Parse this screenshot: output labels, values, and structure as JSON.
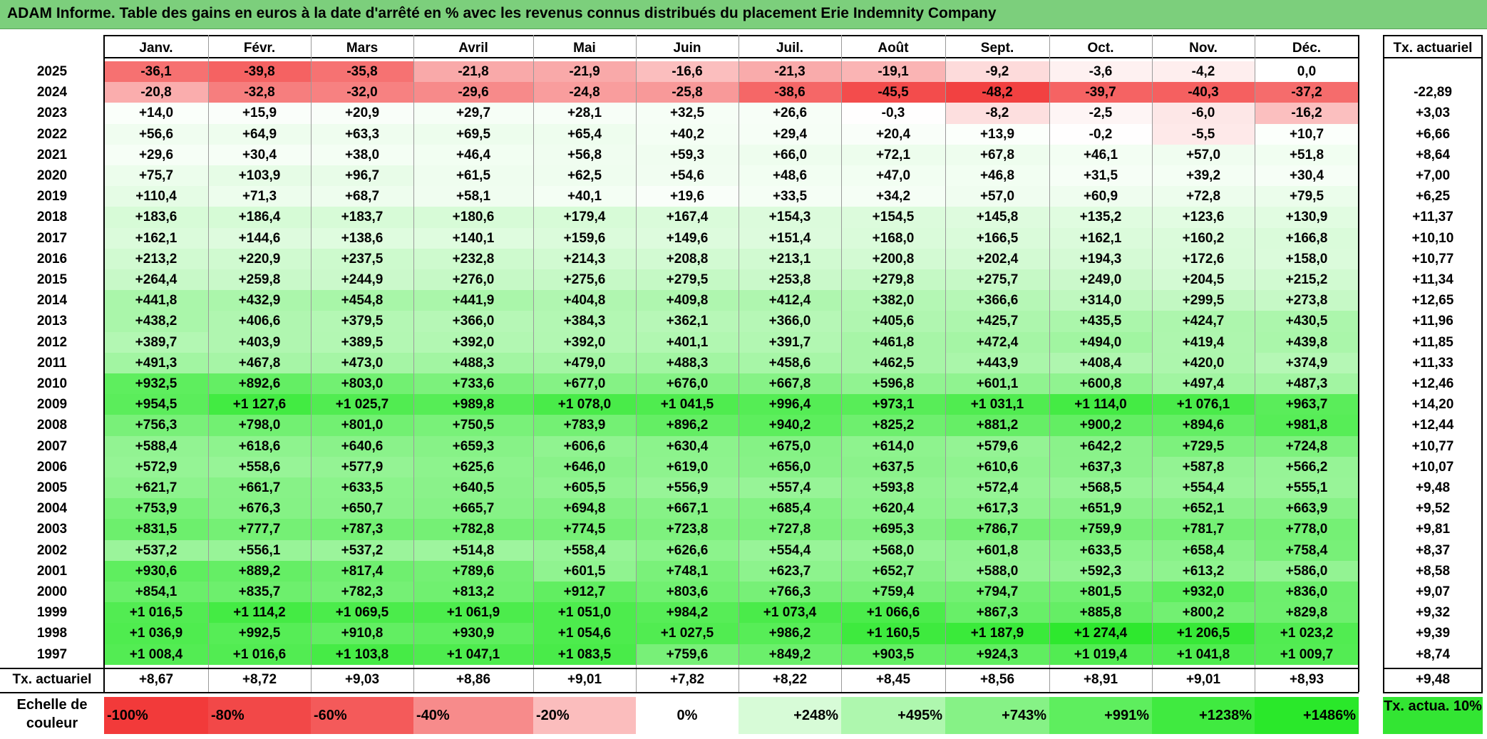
{
  "title": "ADAM Informe. Table des gains en euros à la date d'arrêté en % avec les revenus connus distribués du placement Erie Indemnity Company",
  "months": [
    "Janv.",
    "Févr.",
    "Mars",
    "Avril",
    "Mai",
    "Juin",
    "Juil.",
    "Août",
    "Sept.",
    "Oct.",
    "Nov.",
    "Déc."
  ],
  "rate_header": "Tx. actuariel",
  "rows": [
    {
      "year": "2025",
      "values": [
        "-36,1",
        "-39,8",
        "-35,8",
        "-21,8",
        "-21,9",
        "-16,6",
        "-21,3",
        "-19,1",
        "-9,2",
        "-3,6",
        "-4,2",
        "0,0"
      ],
      "rate": ""
    },
    {
      "year": "2024",
      "values": [
        "-20,8",
        "-32,8",
        "-32,0",
        "-29,6",
        "-24,8",
        "-25,8",
        "-38,6",
        "-45,5",
        "-48,2",
        "-39,7",
        "-40,3",
        "-37,2"
      ],
      "rate": "-22,89"
    },
    {
      "year": "2023",
      "values": [
        "+14,0",
        "+15,9",
        "+20,9",
        "+29,7",
        "+28,1",
        "+32,5",
        "+26,6",
        "-0,3",
        "-8,2",
        "-2,5",
        "-6,0",
        "-16,2"
      ],
      "rate": "+3,03"
    },
    {
      "year": "2022",
      "values": [
        "+56,6",
        "+64,9",
        "+63,3",
        "+69,5",
        "+65,4",
        "+40,2",
        "+29,4",
        "+20,4",
        "+13,9",
        "-0,2",
        "-5,5",
        "+10,7"
      ],
      "rate": "+6,66"
    },
    {
      "year": "2021",
      "values": [
        "+29,6",
        "+30,4",
        "+38,0",
        "+46,4",
        "+56,8",
        "+59,3",
        "+66,0",
        "+72,1",
        "+67,8",
        "+46,1",
        "+57,0",
        "+51,8"
      ],
      "rate": "+8,64"
    },
    {
      "year": "2020",
      "values": [
        "+75,7",
        "+103,9",
        "+96,7",
        "+61,5",
        "+62,5",
        "+54,6",
        "+48,6",
        "+47,0",
        "+46,8",
        "+31,5",
        "+39,2",
        "+30,4"
      ],
      "rate": "+7,00"
    },
    {
      "year": "2019",
      "values": [
        "+110,4",
        "+71,3",
        "+68,7",
        "+58,1",
        "+40,1",
        "+19,6",
        "+33,5",
        "+34,2",
        "+57,0",
        "+60,9",
        "+72,8",
        "+79,5"
      ],
      "rate": "+6,25"
    },
    {
      "year": "2018",
      "values": [
        "+183,6",
        "+186,4",
        "+183,7",
        "+180,6",
        "+179,4",
        "+167,4",
        "+154,3",
        "+154,5",
        "+145,8",
        "+135,2",
        "+123,6",
        "+130,9"
      ],
      "rate": "+11,37"
    },
    {
      "year": "2017",
      "values": [
        "+162,1",
        "+144,6",
        "+138,6",
        "+140,1",
        "+159,6",
        "+149,6",
        "+151,4",
        "+168,0",
        "+166,5",
        "+162,1",
        "+160,2",
        "+166,8"
      ],
      "rate": "+10,10"
    },
    {
      "year": "2016",
      "values": [
        "+213,2",
        "+220,9",
        "+237,5",
        "+232,8",
        "+214,3",
        "+208,8",
        "+213,1",
        "+200,8",
        "+202,4",
        "+194,3",
        "+172,6",
        "+158,0"
      ],
      "rate": "+10,77"
    },
    {
      "year": "2015",
      "values": [
        "+264,4",
        "+259,8",
        "+244,9",
        "+276,0",
        "+275,6",
        "+279,5",
        "+253,8",
        "+279,8",
        "+275,7",
        "+249,0",
        "+204,5",
        "+215,2"
      ],
      "rate": "+11,34"
    },
    {
      "year": "2014",
      "values": [
        "+441,8",
        "+432,9",
        "+454,8",
        "+441,9",
        "+404,8",
        "+409,8",
        "+412,4",
        "+382,0",
        "+366,6",
        "+314,0",
        "+299,5",
        "+273,8"
      ],
      "rate": "+12,65"
    },
    {
      "year": "2013",
      "values": [
        "+438,2",
        "+406,6",
        "+379,5",
        "+366,0",
        "+384,3",
        "+362,1",
        "+366,0",
        "+405,6",
        "+425,7",
        "+435,5",
        "+424,7",
        "+430,5"
      ],
      "rate": "+11,96"
    },
    {
      "year": "2012",
      "values": [
        "+389,7",
        "+403,9",
        "+389,5",
        "+392,0",
        "+392,0",
        "+401,1",
        "+391,7",
        "+461,8",
        "+472,4",
        "+494,0",
        "+419,4",
        "+439,8"
      ],
      "rate": "+11,85"
    },
    {
      "year": "2011",
      "values": [
        "+491,3",
        "+467,8",
        "+473,0",
        "+488,3",
        "+479,0",
        "+488,3",
        "+458,6",
        "+462,5",
        "+443,9",
        "+408,4",
        "+420,0",
        "+374,9"
      ],
      "rate": "+11,33"
    },
    {
      "year": "2010",
      "values": [
        "+932,5",
        "+892,6",
        "+803,0",
        "+733,6",
        "+677,0",
        "+676,0",
        "+667,8",
        "+596,8",
        "+601,1",
        "+600,8",
        "+497,4",
        "+487,3"
      ],
      "rate": "+12,46"
    },
    {
      "year": "2009",
      "values": [
        "+954,5",
        "+1 127,6",
        "+1 025,7",
        "+989,8",
        "+1 078,0",
        "+1 041,5",
        "+996,4",
        "+973,1",
        "+1 031,1",
        "+1 114,0",
        "+1 076,1",
        "+963,7"
      ],
      "rate": "+14,20"
    },
    {
      "year": "2008",
      "values": [
        "+756,3",
        "+798,0",
        "+801,0",
        "+750,5",
        "+783,9",
        "+896,2",
        "+940,2",
        "+825,2",
        "+881,2",
        "+900,2",
        "+894,6",
        "+981,8"
      ],
      "rate": "+12,44"
    },
    {
      "year": "2007",
      "values": [
        "+588,4",
        "+618,6",
        "+640,6",
        "+659,3",
        "+606,6",
        "+630,4",
        "+675,0",
        "+614,0",
        "+579,6",
        "+642,2",
        "+729,5",
        "+724,8"
      ],
      "rate": "+10,77"
    },
    {
      "year": "2006",
      "values": [
        "+572,9",
        "+558,6",
        "+577,9",
        "+625,6",
        "+646,0",
        "+619,0",
        "+656,0",
        "+637,5",
        "+610,6",
        "+637,3",
        "+587,8",
        "+566,2"
      ],
      "rate": "+10,07"
    },
    {
      "year": "2005",
      "values": [
        "+621,7",
        "+661,7",
        "+633,5",
        "+640,5",
        "+605,5",
        "+556,9",
        "+557,4",
        "+593,8",
        "+572,4",
        "+568,5",
        "+554,4",
        "+555,1"
      ],
      "rate": "+9,48"
    },
    {
      "year": "2004",
      "values": [
        "+753,9",
        "+676,3",
        "+650,7",
        "+665,7",
        "+694,8",
        "+667,1",
        "+685,4",
        "+620,4",
        "+617,3",
        "+651,9",
        "+652,1",
        "+663,9"
      ],
      "rate": "+9,52"
    },
    {
      "year": "2003",
      "values": [
        "+831,5",
        "+777,7",
        "+787,3",
        "+782,8",
        "+774,5",
        "+723,8",
        "+727,8",
        "+695,3",
        "+786,7",
        "+759,9",
        "+781,7",
        "+778,0"
      ],
      "rate": "+9,81"
    },
    {
      "year": "2002",
      "values": [
        "+537,2",
        "+556,1",
        "+537,2",
        "+514,8",
        "+558,4",
        "+626,6",
        "+554,4",
        "+568,0",
        "+601,8",
        "+633,5",
        "+658,4",
        "+758,4"
      ],
      "rate": "+8,37"
    },
    {
      "year": "2001",
      "values": [
        "+930,6",
        "+889,2",
        "+817,4",
        "+789,6",
        "+601,5",
        "+748,1",
        "+623,7",
        "+652,7",
        "+588,0",
        "+592,3",
        "+613,2",
        "+586,0"
      ],
      "rate": "+8,58"
    },
    {
      "year": "2000",
      "values": [
        "+854,1",
        "+835,7",
        "+782,3",
        "+813,2",
        "+912,7",
        "+803,6",
        "+766,3",
        "+759,4",
        "+794,7",
        "+801,5",
        "+932,0",
        "+836,0"
      ],
      "rate": "+9,07"
    },
    {
      "year": "1999",
      "values": [
        "+1 016,5",
        "+1 114,2",
        "+1 069,5",
        "+1 061,9",
        "+1 051,0",
        "+984,2",
        "+1 073,4",
        "+1 066,6",
        "+867,3",
        "+885,8",
        "+800,2",
        "+829,8"
      ],
      "rate": "+9,32"
    },
    {
      "year": "1998",
      "values": [
        "+1 036,9",
        "+992,5",
        "+910,8",
        "+930,9",
        "+1 054,6",
        "+1 027,5",
        "+986,2",
        "+1 160,5",
        "+1 187,9",
        "+1 274,4",
        "+1 206,5",
        "+1 023,2"
      ],
      "rate": "+9,39"
    },
    {
      "year": "1997",
      "values": [
        "+1 008,4",
        "+1 016,6",
        "+1 103,8",
        "+1 047,1",
        "+1 083,5",
        "+759,6",
        "+849,2",
        "+903,5",
        "+924,3",
        "+1 019,4",
        "+1 041,8",
        "+1 009,7"
      ],
      "rate": "+8,74"
    }
  ],
  "footer": {
    "label": "Tx. actuariel",
    "values": [
      "+8,67",
      "+8,72",
      "+9,03",
      "+8,86",
      "+9,01",
      "+7,82",
      "+8,22",
      "+8,45",
      "+8,56",
      "+8,91",
      "+9,01",
      "+8,93"
    ],
    "rate": "+9,48"
  },
  "scale": {
    "label": "Echelle de couleur",
    "steps": [
      {
        "text": "-100%",
        "color": "#f23a3a"
      },
      {
        "text": "-80%",
        "color": "#f24848"
      },
      {
        "text": "-60%",
        "color": "#f45a5a"
      },
      {
        "text": "-40%",
        "color": "#f78b8b"
      },
      {
        "text": "-20%",
        "color": "#fbbdbd"
      },
      {
        "text": "0%",
        "color": "#ffffff"
      },
      {
        "text": "+248%",
        "color": "#d7fbd7"
      },
      {
        "text": "+495%",
        "color": "#aef7ae"
      },
      {
        "text": "+743%",
        "color": "#86f286"
      },
      {
        "text": "+991%",
        "color": "#5eee5e"
      },
      {
        "text": "+1238%",
        "color": "#40ea40"
      },
      {
        "text": "+1486%",
        "color": "#2ae82a"
      }
    ],
    "rate_label": "Tx. actua. 10%",
    "rate_color": "#33e533"
  },
  "colors": {
    "title_bg": "#7ccf7c",
    "positive_max": "#2ae82a",
    "negative_max": "#f23a3a"
  }
}
